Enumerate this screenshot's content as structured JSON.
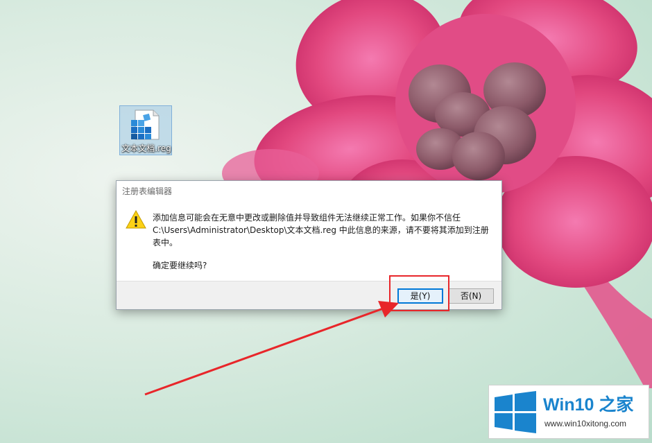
{
  "desktop": {
    "icon_label": "文本文档.reg",
    "icon_name": "registry-file-icon"
  },
  "dialog": {
    "title": "注册表编辑器",
    "icon_name": "warning-icon",
    "message_lines": [
      "添加信息可能会在无意中更改或删除值并导致组件无法继续正常工作。如果你不信任",
      "C:\\Users\\Administrator\\Desktop\\文本文档.reg 中此信息的来源，请不要将其添加到注册",
      "表中。"
    ],
    "confirm_text": "确定要继续吗?",
    "yes_label": "是(Y)",
    "no_label": "否(N)"
  },
  "annotation": {
    "highlight_color": "#e8262a",
    "arrow_color": "#e8262a"
  },
  "watermark": {
    "title": "Win10 之家",
    "url": "www.win10xitong.com",
    "logo_color": "#1a84cd"
  }
}
